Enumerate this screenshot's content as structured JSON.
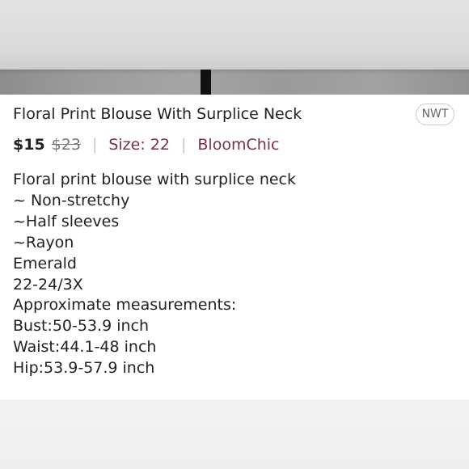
{
  "listing": {
    "title": "Floral Print Blouse With Surplice Neck",
    "condition_badge": "NWT",
    "price": "$15",
    "original_price": "$23",
    "size_label": "Size: 22",
    "brand": "BloomChic",
    "description_lines": [
      "Floral print blouse with surplice neck",
      "~ Non-stretchy",
      "~Half sleeves",
      "~Rayon",
      "Emerald",
      "22-24/3X",
      "Approximate measurements:",
      "Bust:50-53.9 inch",
      "Waist:44.1-48 inch",
      "Hip:53.9-57.9 inch"
    ]
  },
  "colors": {
    "accent": "#7a2f45",
    "text": "#222222",
    "muted": "#777777"
  }
}
